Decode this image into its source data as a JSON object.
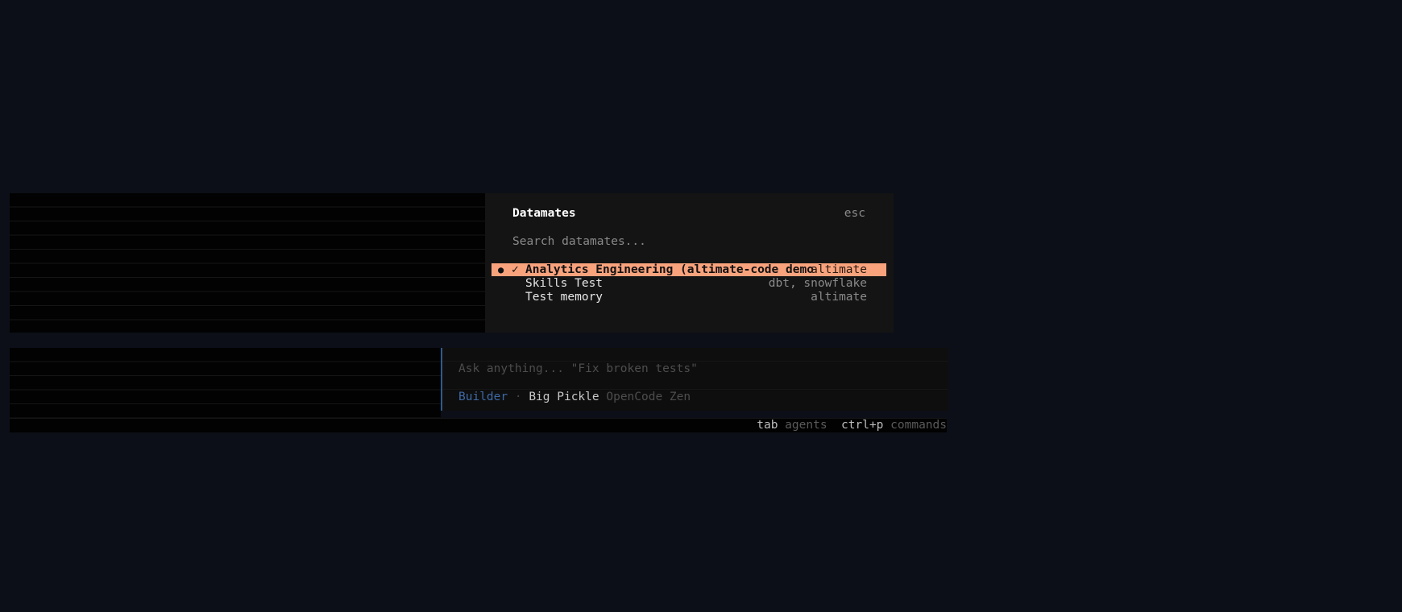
{
  "dialog": {
    "title": "Datamates",
    "close_hint": "esc",
    "search_placeholder": "Search datamates...",
    "options": [
      {
        "bullet": "●",
        "check": "✓",
        "label": "Analytics Engineering (altimate-code demo",
        "tag": "altimate",
        "selected": true
      },
      {
        "label": "Skills Test",
        "tag": "dbt, snowflake",
        "selected": false
      },
      {
        "label": "Test memory",
        "tag": "altimate",
        "selected": false
      }
    ]
  },
  "prompt": {
    "placeholder": "Ask anything... \"Fix broken tests\"",
    "agent": "Builder",
    "separator": "·",
    "model": "Big Pickle",
    "provider": "OpenCode Zen"
  },
  "status": {
    "hint1_key": "tab",
    "hint1_label": "agents",
    "hint2_key": "ctrl+p",
    "hint2_label": "commands"
  },
  "colors": {
    "background": "#0c0f17",
    "selected_option": "#f9a37d",
    "agent_accent": "#3e6aa6"
  }
}
